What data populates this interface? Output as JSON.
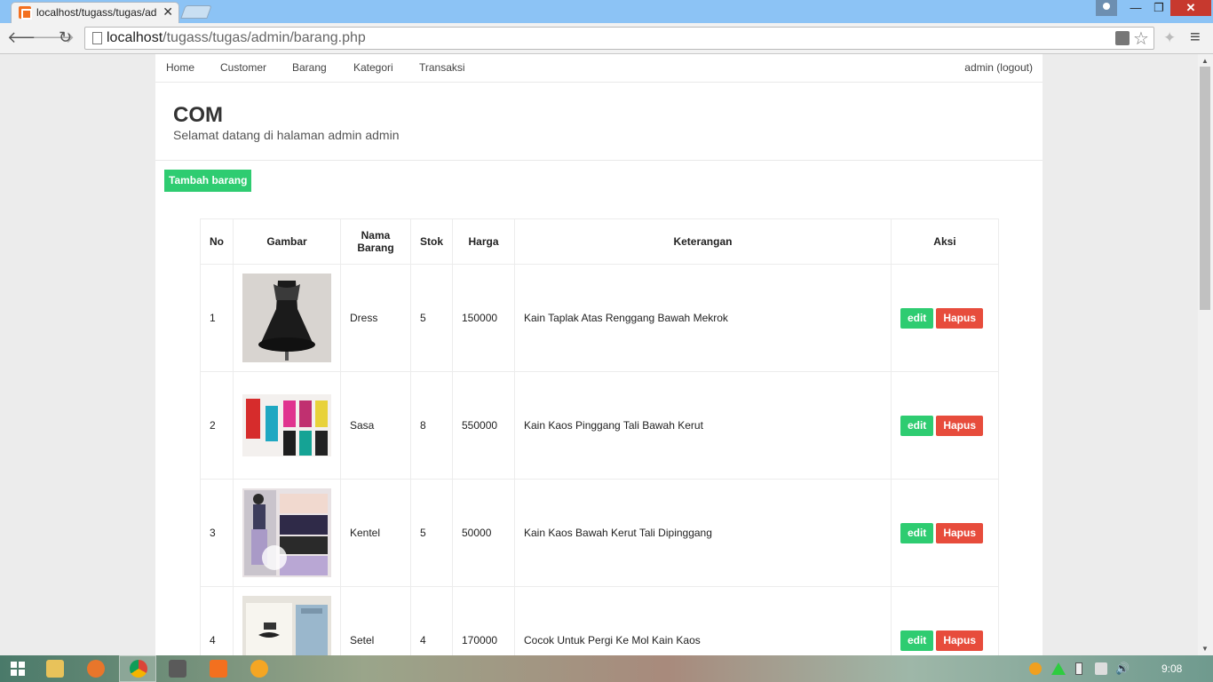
{
  "browser": {
    "tab_title": "localhost/tugass/tugas/ad",
    "url_host": "localhost",
    "url_path": "/tugass/tugas/admin/barang.php"
  },
  "nav": {
    "items": [
      "Home",
      "Customer",
      "Barang",
      "Kategori",
      "Transaksi"
    ],
    "user": "admin (logout)"
  },
  "hero": {
    "title": "COM",
    "subtitle": "Selamat datang di halaman admin admin"
  },
  "actions": {
    "add_label": "Tambah barang"
  },
  "table": {
    "headers": {
      "no": "No",
      "gambar": "Gambar",
      "nama": "Nama Barang",
      "stok": "Stok",
      "harga": "Harga",
      "keterangan": "Keterangan",
      "aksi": "Aksi"
    },
    "edit_label": "edit",
    "delete_label": "Hapus",
    "rows": [
      {
        "no": "1",
        "nama": "Dress",
        "stok": "5",
        "harga": "150000",
        "keterangan": "Kain Taplak Atas Renggang Bawah Mekrok"
      },
      {
        "no": "2",
        "nama": "Sasa",
        "stok": "8",
        "harga": "550000",
        "keterangan": "Kain Kaos Pinggang Tali Bawah Kerut"
      },
      {
        "no": "3",
        "nama": "Kentel",
        "stok": "5",
        "harga": "50000",
        "keterangan": "Kain Kaos Bawah Kerut Tali Dipinggang"
      },
      {
        "no": "4",
        "nama": "Setel",
        "stok": "4",
        "harga": "170000",
        "keterangan": "Cocok Untuk Pergi Ke Mol Kain Kaos"
      }
    ]
  },
  "taskbar": {
    "clock": "9:08"
  },
  "colors": {
    "accent_green": "#2ecc71",
    "danger_red": "#e74c3c"
  }
}
